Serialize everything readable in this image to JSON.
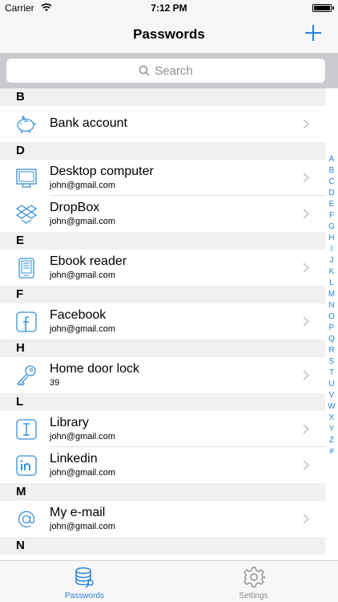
{
  "status_bar": {
    "carrier": "Carrier",
    "time": "7:12 PM"
  },
  "nav": {
    "title": "Passwords",
    "add_icon": "plus-icon"
  },
  "search": {
    "placeholder": "Search"
  },
  "sections": [
    {
      "letter": "B",
      "items": [
        {
          "title": "Bank account",
          "subtitle": "",
          "icon": "piggy-bank-icon"
        }
      ]
    },
    {
      "letter": "D",
      "items": [
        {
          "title": "Desktop computer",
          "subtitle": "john@gmail.com",
          "icon": "monitor-icon"
        },
        {
          "title": "DropBox",
          "subtitle": "john@gmail.com",
          "icon": "dropbox-icon"
        }
      ]
    },
    {
      "letter": "E",
      "items": [
        {
          "title": "Ebook reader",
          "subtitle": "john@gmail.com",
          "icon": "ebook-reader-icon"
        }
      ]
    },
    {
      "letter": "F",
      "items": [
        {
          "title": "Facebook",
          "subtitle": "john@gmail.com",
          "icon": "facebook-icon"
        }
      ]
    },
    {
      "letter": "H",
      "items": [
        {
          "title": "Home door lock",
          "subtitle": "39",
          "icon": "key-icon"
        }
      ]
    },
    {
      "letter": "L",
      "items": [
        {
          "title": "Library",
          "subtitle": "john@gmail.com",
          "icon": "library-icon"
        },
        {
          "title": "Linkedin",
          "subtitle": "john@gmail.com",
          "icon": "linkedin-icon"
        }
      ]
    },
    {
      "letter": "M",
      "items": [
        {
          "title": "My e-mail",
          "subtitle": "john@gmail.com",
          "icon": "at-sign-icon"
        }
      ]
    },
    {
      "letter": "N",
      "items": []
    }
  ],
  "index": [
    "A",
    "B",
    "C",
    "D",
    "E",
    "F",
    "G",
    "H",
    "I",
    "J",
    "K",
    "L",
    "M",
    "N",
    "O",
    "P",
    "Q",
    "R",
    "S",
    "T",
    "U",
    "V",
    "W",
    "X",
    "Y",
    "Z",
    "#"
  ],
  "tabs": [
    {
      "label": "Passwords",
      "icon": "database-key-icon",
      "active": true
    },
    {
      "label": "Settings",
      "icon": "gear-icon",
      "active": false
    }
  ],
  "colors": {
    "accent": "#2a82d8",
    "icon_stroke": "#3a8fd9",
    "inactive": "#8e8e93"
  }
}
